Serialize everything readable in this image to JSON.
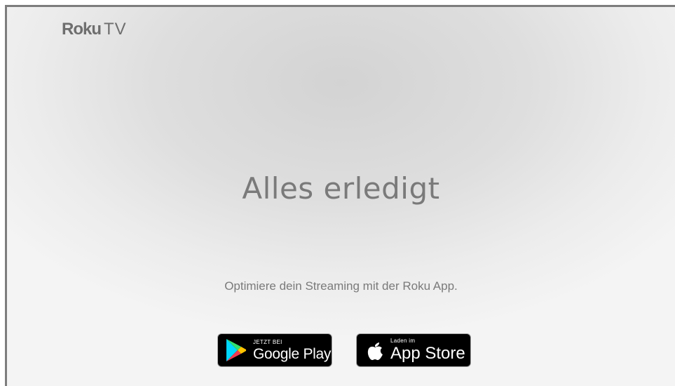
{
  "brand": {
    "name_bold": "Roku",
    "name_light": "TV"
  },
  "main": {
    "headline": "Alles erledigt",
    "subline": "Optimiere dein Streaming mit der Roku App."
  },
  "store_badges": {
    "google": {
      "small_label": "JETZT BEI",
      "big_label": "Google Play",
      "icon": "google-play-icon"
    },
    "apple": {
      "small_label": "Laden im",
      "big_label": "App Store",
      "icon": "apple-icon"
    }
  },
  "colors": {
    "text_gray": "#7a7a7a",
    "frame_gray": "#7d7d7d",
    "badge_black": "#000000"
  }
}
